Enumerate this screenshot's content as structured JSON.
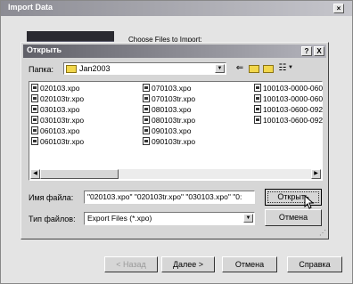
{
  "outer": {
    "title": "Import Data",
    "choose_label": "Choose Files to Import:"
  },
  "dialog": {
    "title": "Открыть",
    "help_button": "?",
    "close_button": "X",
    "folder_label": "Папка:",
    "folder_value": "Jan2003",
    "files": [
      "020103.xpo",
      "020103tr.xpo",
      "030103.xpo",
      "030103tr.xpo",
      "060103.xpo",
      "060103tr.xpo",
      "070103.xpo",
      "070103tr.xpo",
      "080103.xpo",
      "080103tr.xpo",
      "090103.xpo",
      "090103tr.xpo",
      "100103-0000-060",
      "100103-0000-060",
      "100103-0600-092",
      "100103-0600-092"
    ],
    "filename_label": "Имя файла:",
    "filename_value": "\"020103.xpo\" \"020103tr.xpo\" \"030103.xpo\" \"0:",
    "filetype_label": "Тип файлов:",
    "filetype_value": "Export Files (*.xpo)",
    "open_button": "Открыть",
    "cancel_button": "Отмена"
  },
  "footer": {
    "back_button": "< Назад",
    "next_button": "Далее >",
    "cancel_button": "Отмена",
    "help_button": "Справка"
  }
}
